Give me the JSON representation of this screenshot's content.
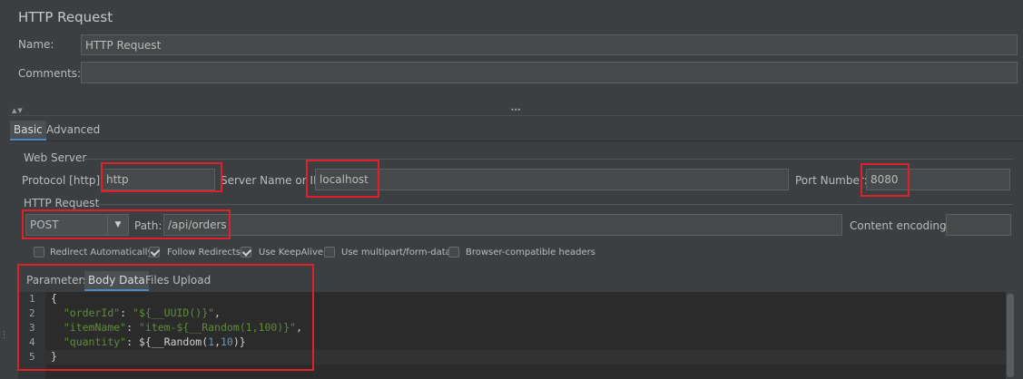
{
  "title": "HTTP Request",
  "name_label": "Name:",
  "name_value": "HTTP Request",
  "comments_label": "Comments:",
  "comments_value": "",
  "collapse_arrows": "▲▼",
  "splitter_dots": "•••",
  "config_tabs": [
    "Basic",
    "Advanced"
  ],
  "web_server": {
    "group_title": "Web Server",
    "protocol_label": "Protocol [http]:",
    "protocol_value": "http",
    "server_label": "Server Name or IP:",
    "server_value": "localhost",
    "port_label": "Port Number:",
    "port_value": "8080"
  },
  "http_request": {
    "group_title": "HTTP Request",
    "method_value": "POST",
    "path_label": "Path:",
    "path_value": "/api/orders",
    "encoding_label": "Content encoding:",
    "encoding_value": ""
  },
  "options": [
    {
      "label": "Redirect Automatically",
      "checked": false
    },
    {
      "label": "Follow Redirects",
      "checked": true
    },
    {
      "label": "Use KeepAlive",
      "checked": true
    },
    {
      "label": "Use multipart/form-data",
      "checked": false
    },
    {
      "label": "Browser-compatible headers",
      "checked": false
    }
  ],
  "body_tabs": [
    "Parameters",
    "Body Data",
    "Files Upload"
  ],
  "line_numbers": [
    "1",
    "2",
    "3",
    "4",
    "5"
  ],
  "code": {
    "l1": "{",
    "l2_key": "\"orderId\"",
    "l2_colon": ": ",
    "l2_val": "\"${__UUID()}\"",
    "l2_end": ",",
    "l3_key": "\"itemName\"",
    "l3_colon": ": ",
    "l3_val": "\"item-${__Random(1,100)}\"",
    "l3_end": ",",
    "l4_key": "\"quantity\"",
    "l4_a": ": ${__Random(",
    "l4_n1": "1",
    "l4_comma": ",",
    "l4_n2": "10",
    "l4_b": ")}",
    "l5": "}"
  },
  "colors": {
    "background": "#3c3f41",
    "field": "#45494a",
    "accent_tab": "#4a88c7",
    "highlight_box": "#e0202a",
    "string": "#5f8c3a",
    "number": "#6897bb"
  }
}
